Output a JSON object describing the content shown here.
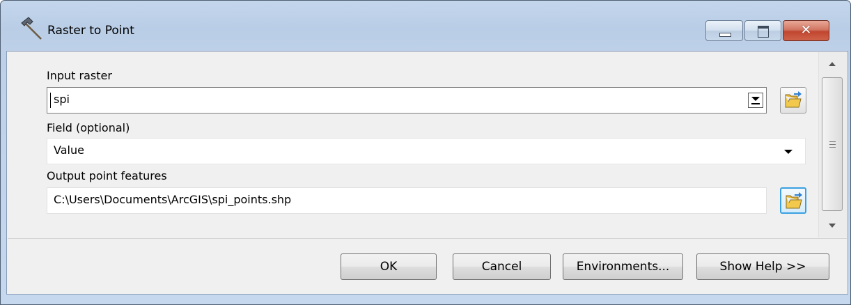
{
  "window": {
    "title": "Raster to Point",
    "minimize_icon": "minimize-icon",
    "maximize_icon": "maximize-icon",
    "close_icon": "close-icon",
    "close_glyph": "✕"
  },
  "form": {
    "input_raster": {
      "label": "Input raster",
      "value": "spi",
      "dropdown_icon": "chevron-down-icon",
      "browse_icon": "open-folder-icon"
    },
    "field": {
      "label": "Field (optional)",
      "value": "Value",
      "dropdown_icon": "chevron-down-icon"
    },
    "output_point_features": {
      "label": "Output point features",
      "value": "C:\\Users\\Documents\\ArcGIS\\spi_points.shp",
      "browse_icon": "open-folder-icon"
    }
  },
  "buttons": {
    "ok": "OK",
    "cancel": "Cancel",
    "environments": "Environments...",
    "show_help": "Show Help >>"
  },
  "colors": {
    "title_bar": "#bfd3ea",
    "close_button": "#c7503a",
    "browse_active": "#3aa0e0"
  }
}
